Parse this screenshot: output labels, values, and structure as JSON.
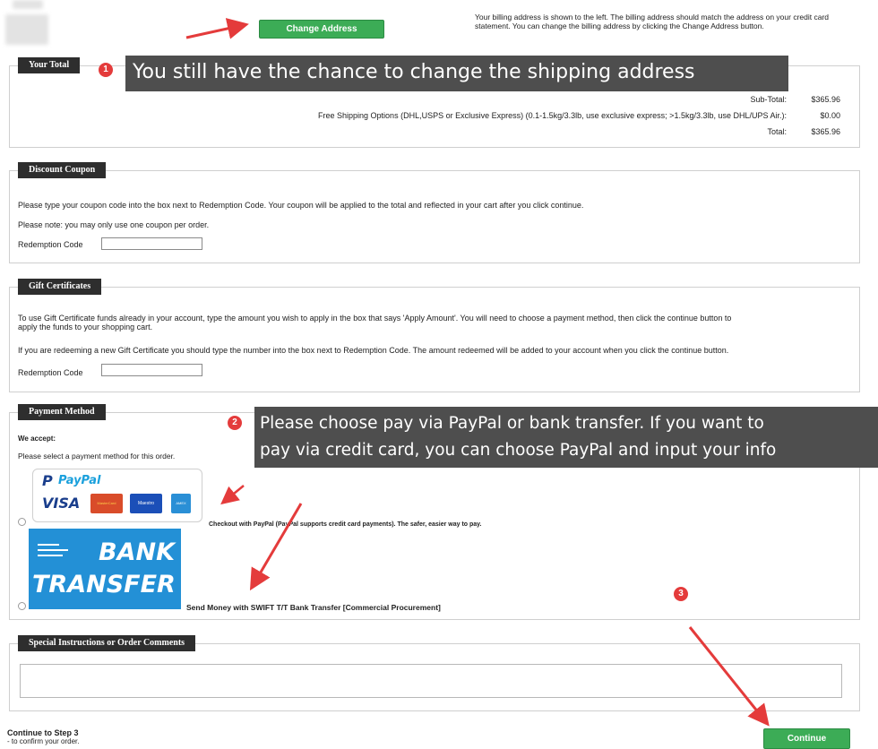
{
  "top": {
    "change_address_label": "Change Address",
    "billing_note": "Your billing address is shown to the left. The billing address should match the address on your credit card statement. You can change the billing address by clicking the Change Address button."
  },
  "total": {
    "legend": "Your Total",
    "rows": [
      {
        "label": "Sub-Total:",
        "value": "$365.96"
      },
      {
        "label": "Free Shipping Options (DHL,USPS or Exclusive Express) (0.1-1.5kg/3.3lb, use exclusive express; >1.5kg/3.3lb, use DHL/UPS Air.):",
        "value": "$0.00"
      },
      {
        "label": "Total:",
        "value": "$365.96"
      }
    ]
  },
  "coupon": {
    "legend": "Discount Coupon",
    "text1": "Please type your coupon code into the box next to Redemption Code. Your coupon will be applied to the total and reflected in your cart after you click continue.",
    "text2": "Please note: you may only use one coupon per order.",
    "code_label": "Redemption Code"
  },
  "gift": {
    "legend": "Gift Certificates",
    "text1a": "To use Gift Certificate funds already in your account, type the amount you wish to apply in the box that says 'Apply Amount'. You will need to choose a payment method, then click the continue button to",
    "text1b": "apply the funds to your shopping cart.",
    "text2": "If you are redeeming a new Gift Certificate you should type the number into the box next to Redemption Code. The amount redeemed will be added to your account when you click the continue button.",
    "code_label": "Redemption Code"
  },
  "payment": {
    "legend": "Payment Method",
    "we_accept": "We accept:",
    "select_text": "Please select a payment method for this order.",
    "paypal_logo": "PayPal",
    "cards": [
      "VISA",
      "MasterCard",
      "Maestro",
      "AMEX"
    ],
    "paypal_desc": "Checkout with PayPal (PayPal supports credit card payments). The safer, easier way to pay.",
    "bank_logo_line1": "BANK",
    "bank_logo_line2": "TRANSFER",
    "bank_desc": "Send Money with SWIFT T/T Bank Transfer [Commercial Procurement]"
  },
  "comments": {
    "legend": "Special Instructions or Order Comments"
  },
  "footer": {
    "step_title": "Continue to Step 3",
    "step_sub": "- to confirm your order.",
    "continue_label": "Continue"
  },
  "annotations": {
    "badge1": "1",
    "callout1": "You still have the chance to change the shipping address",
    "badge2": "2",
    "callout2_line1": "Please choose pay via PayPal or bank transfer. If you want to",
    "callout2_line2": "pay via credit card, you can choose PayPal and input your info",
    "badge3": "3"
  },
  "colors": {
    "accent_green": "#3cac56",
    "legend_bg": "#2e2e2e",
    "annotation_red": "#e43b3b",
    "callout_bg": "#4e4e4e",
    "paypal_blue": "#1a3e8c",
    "bank_blue": "#2390d6"
  }
}
